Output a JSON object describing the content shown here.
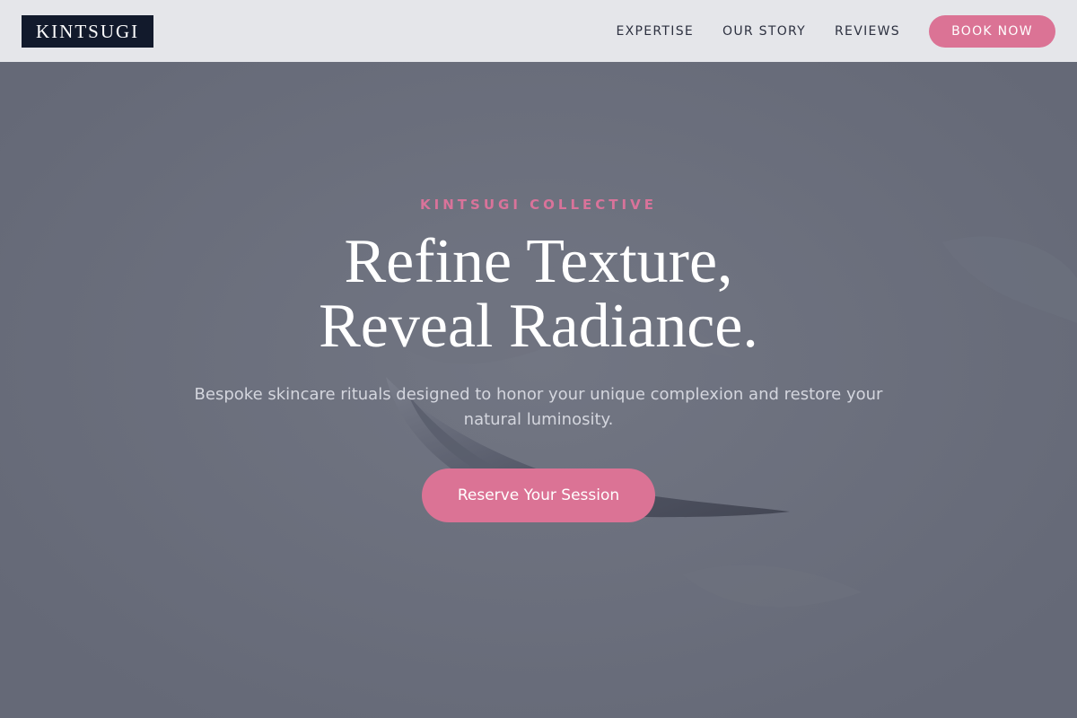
{
  "header": {
    "logo": "KINTSUGI",
    "nav": [
      {
        "label": "EXPERTISE"
      },
      {
        "label": "OUR STORY"
      },
      {
        "label": "REVIEWS"
      }
    ],
    "book_button": "BOOK NOW"
  },
  "hero": {
    "eyebrow": "KINTSUGI COLLECTIVE",
    "headline_line1": "Refine Texture,",
    "headline_line2": "Reveal Radiance.",
    "subtext": "Bespoke skincare rituals designed to honor your unique complexion and restore your natural luminosity.",
    "cta": "Reserve Your Session"
  },
  "colors": {
    "accent_pink": "#db7395",
    "logo_navy": "#121a2c",
    "hero_overlay": "#676b79",
    "header_bg": "#e9eaed"
  }
}
